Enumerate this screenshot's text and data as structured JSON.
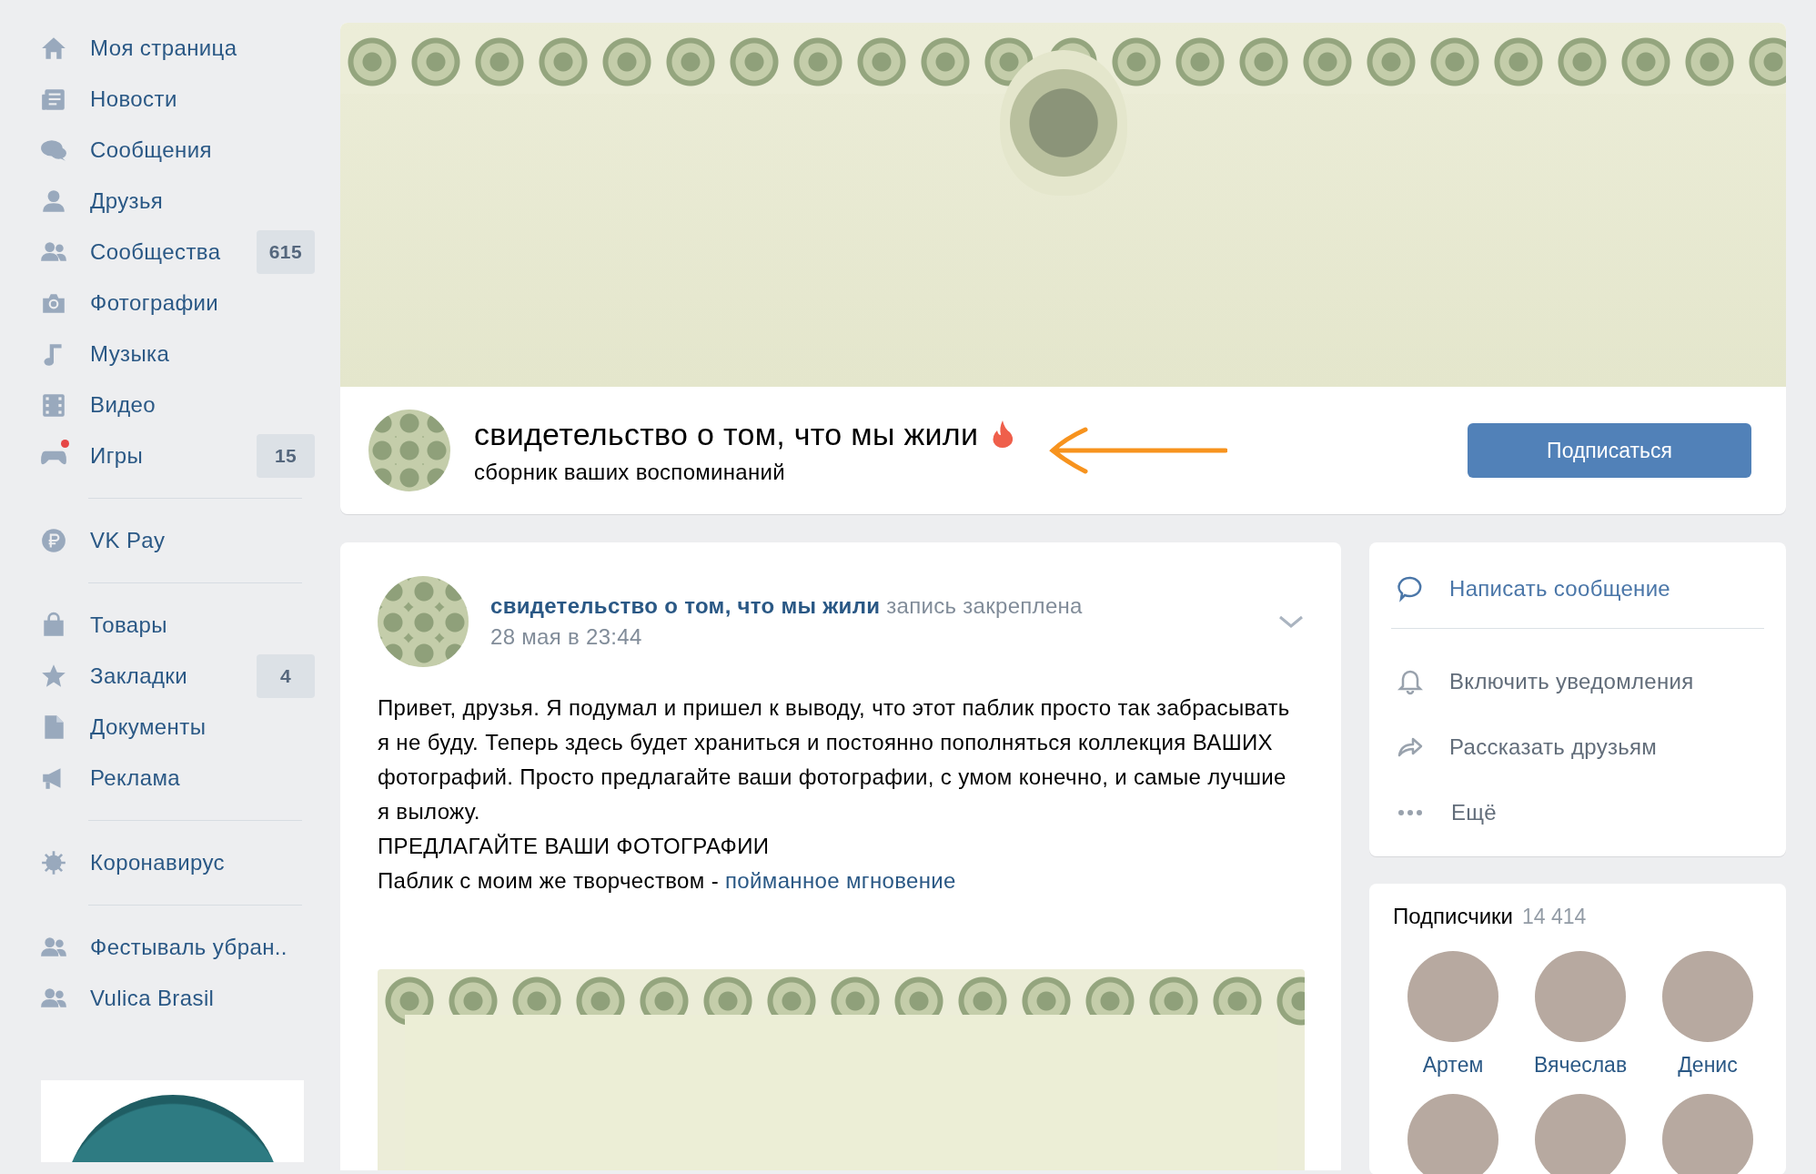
{
  "sidebar": {
    "sections": [
      {
        "items": [
          {
            "label": "Моя страница",
            "notification": false
          },
          {
            "label": "Новости",
            "notification": false
          },
          {
            "label": "Сообщения",
            "notification": false
          },
          {
            "label": "Друзья",
            "notification": false
          },
          {
            "label": "Сообщества",
            "count": "615",
            "notification": false
          },
          {
            "label": "Фотографии",
            "notification": false
          },
          {
            "label": "Музыка",
            "notification": false
          },
          {
            "label": "Видео",
            "notification": false
          },
          {
            "label": "Игры",
            "count": "15",
            "notification": true
          }
        ]
      },
      {
        "items": [
          {
            "label": "VK Pay",
            "notification": false
          }
        ]
      },
      {
        "items": [
          {
            "label": "Товары",
            "notification": false
          },
          {
            "label": "Закладки",
            "count": "4",
            "notification": false
          },
          {
            "label": "Документы",
            "notification": false
          },
          {
            "label": "Реклама",
            "notification": false
          }
        ]
      },
      {
        "items": [
          {
            "label": "Коронавирус",
            "notification": false
          }
        ]
      },
      {
        "items": [
          {
            "label": "Фестываль убран..",
            "notification": false
          },
          {
            "label": "Vulica Brasil",
            "notification": false
          }
        ]
      }
    ]
  },
  "group": {
    "name": "свидетельство о том, что мы жили",
    "status": "сборник ваших воспоминаний",
    "subscribe_button": "Подписаться"
  },
  "post": {
    "author": "свидетельство о том, что мы жили",
    "pinned_note": "запись закреплена",
    "date": "28 мая в 23:44",
    "paragraphs": [
      "Привет, друзья. Я подумал и пришел к выводу, что этот паблик просто так забрасывать я не буду. Теперь здесь будет храниться и постоянно пополняться коллекция ВАШИХ фотографий. Просто предлагайте ваши фотографии, с умом конечно, и самые лучшие я выложу.",
      "ПРЕДЛАГАЙТЕ ВАШИ ФОТОГРАФИИ"
    ],
    "link_line": {
      "text": "Паблик с моим же творчеством - ",
      "link": "пойманное мгновение"
    }
  },
  "actions": [
    {
      "label": "Написать сообщение",
      "kind": "primary"
    },
    {
      "label": "Включить уведомления",
      "kind": "secondary"
    },
    {
      "label": "Рассказать друзьям",
      "kind": "secondary"
    },
    {
      "label": "Ещё",
      "kind": "secondary"
    }
  ],
  "subscribers": {
    "title": "Подписчики",
    "count": "14 414",
    "people": [
      {
        "name": "Артем"
      },
      {
        "name": "Вячеслав"
      },
      {
        "name": "Денис"
      }
    ]
  }
}
